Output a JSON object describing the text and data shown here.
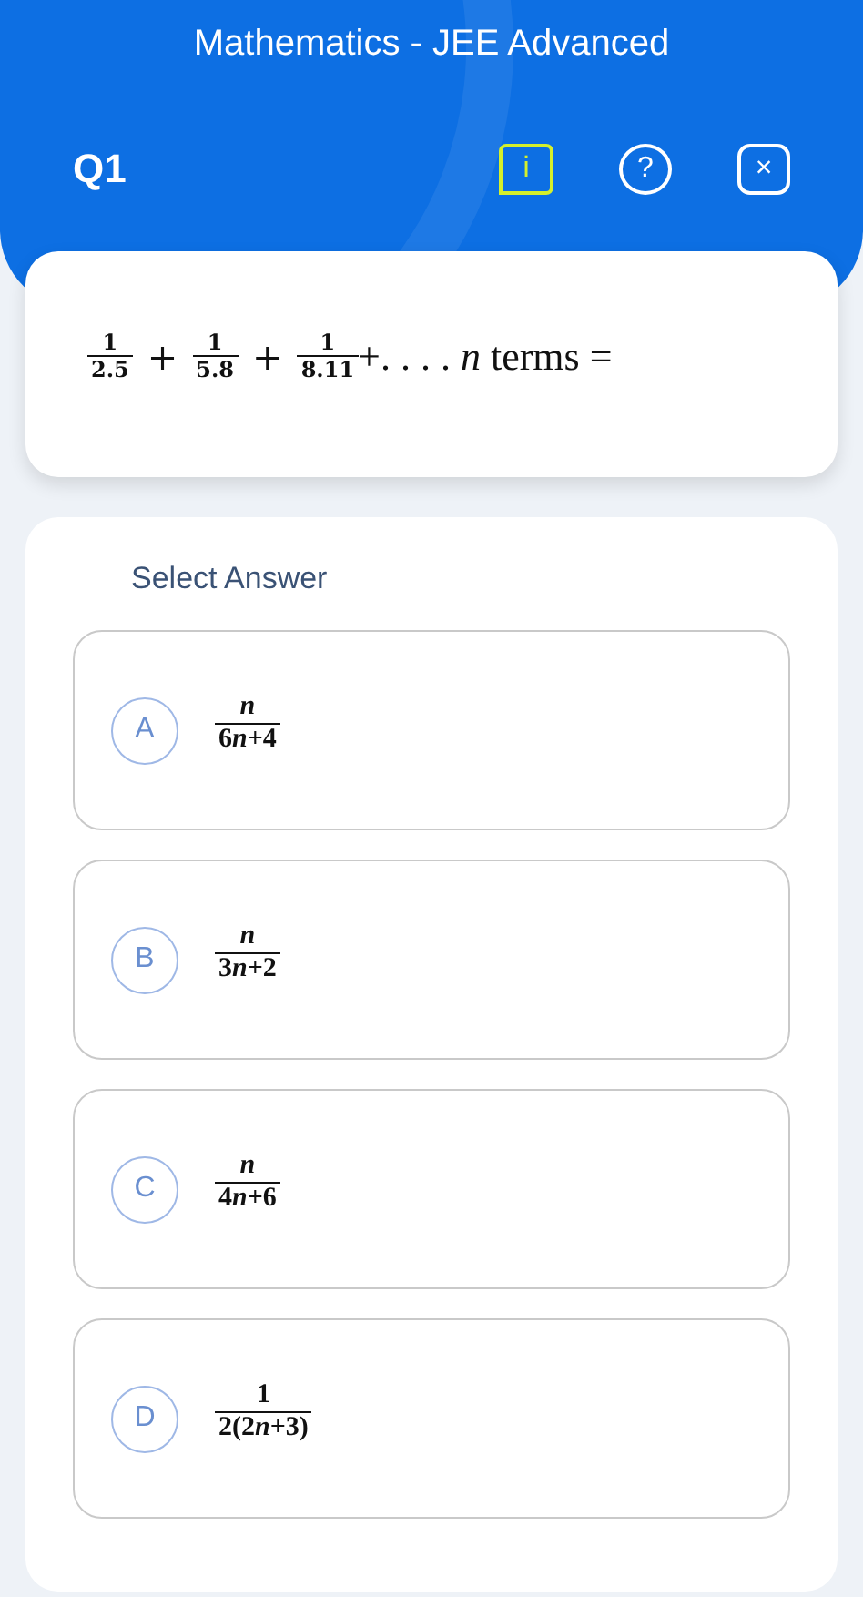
{
  "header": {
    "title": "Mathematics - JEE Advanced",
    "question_number": "Q1",
    "info_icon_text": "i",
    "help_icon_text": "?",
    "close_icon_text": "×"
  },
  "question": {
    "parts": [
      {
        "kind": "frac",
        "num": "1",
        "den": "2.5"
      },
      {
        "kind": "op",
        "text": "+"
      },
      {
        "kind": "frac",
        "num": "1",
        "den": "5.8"
      },
      {
        "kind": "op",
        "text": "+"
      },
      {
        "kind": "frac",
        "num": "1",
        "den": "8.11"
      },
      {
        "kind": "text",
        "text": "+. . . . *n* terms ="
      }
    ]
  },
  "answers": {
    "heading": "Select Answer",
    "options": [
      {
        "letter": "A",
        "num": [
          {
            "kind": "var",
            "text": "n"
          }
        ],
        "den": [
          {
            "kind": "num",
            "text": "6"
          },
          {
            "kind": "var",
            "text": "n"
          },
          {
            "kind": "num",
            "text": "+4"
          }
        ],
        "selected": false
      },
      {
        "letter": "B",
        "num": [
          {
            "kind": "var",
            "text": "n"
          }
        ],
        "den": [
          {
            "kind": "num",
            "text": "3"
          },
          {
            "kind": "var",
            "text": "n"
          },
          {
            "kind": "num",
            "text": "+2"
          }
        ],
        "selected": false
      },
      {
        "letter": "C",
        "num": [
          {
            "kind": "var",
            "text": "n"
          }
        ],
        "den": [
          {
            "kind": "num",
            "text": "4"
          },
          {
            "kind": "var",
            "text": "n"
          },
          {
            "kind": "num",
            "text": "+6"
          }
        ],
        "selected": false
      },
      {
        "letter": "D",
        "num": [
          {
            "kind": "num",
            "text": "1"
          }
        ],
        "den": [
          {
            "kind": "num",
            "text": "2(2"
          },
          {
            "kind": "var",
            "text": "n"
          },
          {
            "kind": "num",
            "text": "+3)"
          }
        ],
        "selected": false
      }
    ]
  }
}
